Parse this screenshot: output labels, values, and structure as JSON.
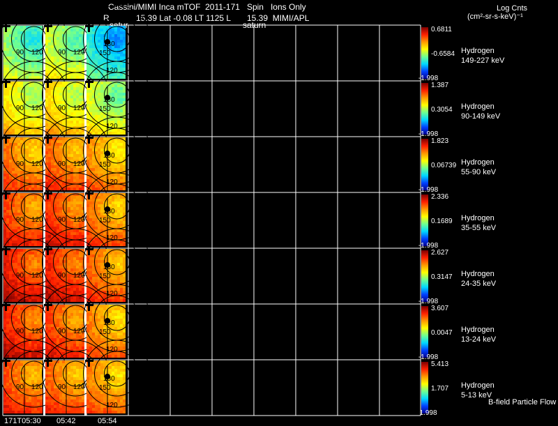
{
  "header": {
    "title": "Cassini/MIMI Inca mTOF  2011-171   Spin   Ions Only",
    "r_label": "R",
    "position_line": "15.39 Lat -0.08 LT 1125 L       15.39  MIMI/APL",
    "saturn_label_1": "satur",
    "saturn_label_2": "saturn",
    "units_title": "Log Cnts",
    "units": "(cm²-sr-s-keV)⁻¹"
  },
  "footer": {
    "time_labels": [
      "171T05:30",
      "05:42",
      "05:54"
    ],
    "bfield_label": "B-field Particle Flow"
  },
  "chart_data": {
    "type": "heatmap",
    "title": "Cassini/MIMI Inca mTOF  2011-171   Spin   Ions Only",
    "times": [
      "171T05:30",
      "05:42",
      "05:54"
    ],
    "contour_labels": [
      "90",
      "120",
      "150",
      "180",
      "15",
      "120"
    ],
    "colorscale": [
      "#00008f",
      "#0040ff",
      "#00d8ff",
      "#70ff90",
      "#ffff00",
      "#ff9800",
      "#ff2000",
      "#7f0000"
    ],
    "panels": [
      {
        "species": "Hydrogen",
        "energy": "149-227 keV",
        "cbar_max": "0.6811",
        "cbar_mid": "-0.6584",
        "cbar_min": "-1.998",
        "base_levels": [
          0.42,
          0.48,
          0.3
        ]
      },
      {
        "species": "Hydrogen",
        "energy": "90-149 keV",
        "cbar_max": "1.387",
        "cbar_mid": "0.3054",
        "cbar_min": "-1.998",
        "base_levels": [
          0.56,
          0.58,
          0.5
        ]
      },
      {
        "species": "Hydrogen",
        "energy": "55-90 keV",
        "cbar_max": "1.823",
        "cbar_mid": "0.06739",
        "cbar_min": "-1.998",
        "base_levels": [
          0.72,
          0.74,
          0.68
        ]
      },
      {
        "species": "Hydrogen",
        "energy": "35-55 keV",
        "cbar_max": "2.336",
        "cbar_mid": "0.1689",
        "cbar_min": "-1.998",
        "base_levels": [
          0.78,
          0.8,
          0.72
        ]
      },
      {
        "species": "Hydrogen",
        "energy": "24-35 keV",
        "cbar_max": "2.627",
        "cbar_mid": "0.3147",
        "cbar_min": "-1.998",
        "base_levels": [
          0.84,
          0.83,
          0.74
        ]
      },
      {
        "species": "Hydrogen",
        "energy": "13-24 keV",
        "cbar_max": "3.607",
        "cbar_mid": "0.0047",
        "cbar_min": "-1.998",
        "base_levels": [
          0.82,
          0.78,
          0.7
        ]
      },
      {
        "species": "Hydrogen",
        "energy": "5-13 keV",
        "cbar_max": "5.413",
        "cbar_mid": "1.707",
        "cbar_min": "1.998",
        "base_levels": [
          0.76,
          0.74,
          0.7
        ]
      }
    ]
  }
}
